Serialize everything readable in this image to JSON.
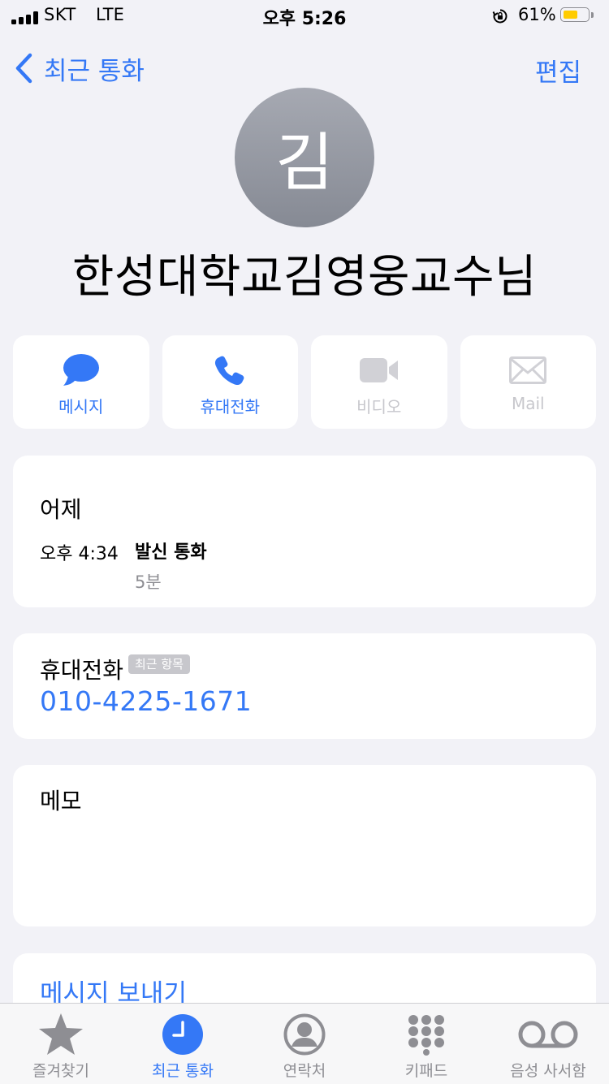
{
  "status_bar": {
    "carrier": "SKT",
    "network": "LTE",
    "time": "오후 5:26",
    "battery_percent": "61%",
    "battery_level": 0.61
  },
  "nav": {
    "back_label": "최근 통화",
    "edit_label": "편집"
  },
  "contact": {
    "initial": "김",
    "name": "한성대학교김영웅교수님"
  },
  "actions": [
    {
      "label": "메시지",
      "icon": "message-bubble-icon",
      "enabled": true
    },
    {
      "label": "휴대전화",
      "icon": "phone-icon",
      "enabled": true
    },
    {
      "label": "비디오",
      "icon": "video-camera-icon",
      "enabled": false
    },
    {
      "label": "Mail",
      "icon": "mail-envelope-icon",
      "enabled": false
    }
  ],
  "call_history": {
    "date": "어제",
    "time": "오후 4:34",
    "type": "발신 통화",
    "duration": "5분"
  },
  "phone": {
    "label": "휴대전화",
    "badge": "최근 항목",
    "number": "010-4225-1671"
  },
  "memo": {
    "label": "메모"
  },
  "send_message": {
    "label": "메시지 보내기"
  },
  "tab_bar": [
    {
      "label": "즐겨찾기",
      "icon": "star-icon",
      "active": false
    },
    {
      "label": "최근 통화",
      "icon": "clock-icon",
      "active": true
    },
    {
      "label": "연락처",
      "icon": "person-circle-icon",
      "active": false
    },
    {
      "label": "키패드",
      "icon": "keypad-icon",
      "active": false
    },
    {
      "label": "음성 사서함",
      "icon": "voicemail-icon",
      "active": false
    }
  ],
  "colors": {
    "accent": "#3478f6",
    "background": "#f2f2f7",
    "disabled": "#c7c7cc",
    "battery": "#ffcc00"
  }
}
